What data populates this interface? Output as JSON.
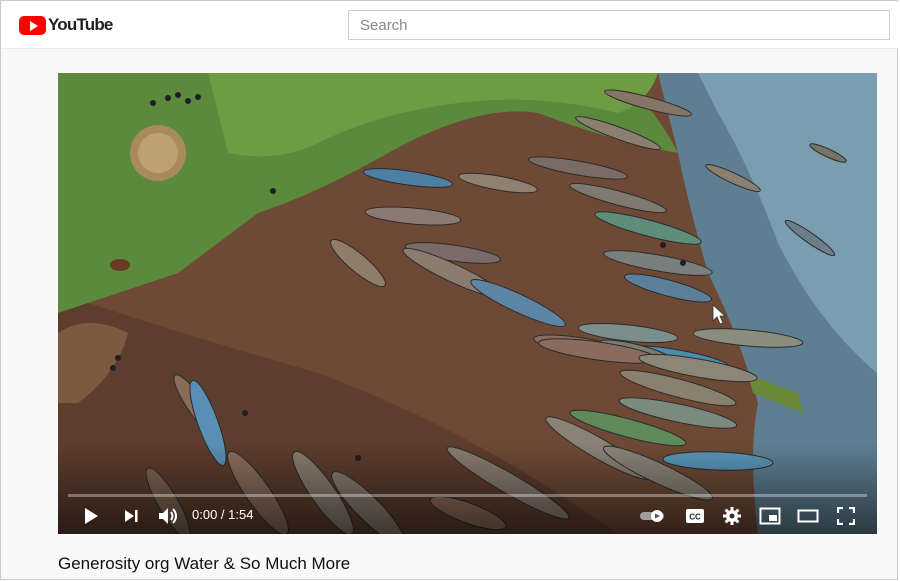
{
  "header": {
    "logo_text": "YouTube",
    "search_placeholder": "Search"
  },
  "player": {
    "time_current": "0:00",
    "time_separator": " / ",
    "time_total": "1:54",
    "progress": 0,
    "icons": [
      "play-icon",
      "next-icon",
      "volume-icon",
      "autoplay-toggle-icon",
      "captions-icon",
      "settings-icon",
      "miniplayer-icon",
      "theater-mode-icon",
      "fullscreen-icon"
    ],
    "captions_label": "CC"
  },
  "video": {
    "title": "Generosity org Water & So Much More"
  },
  "colors": {
    "brand_red": "#ff0000",
    "player_bar": "#ffffff"
  }
}
